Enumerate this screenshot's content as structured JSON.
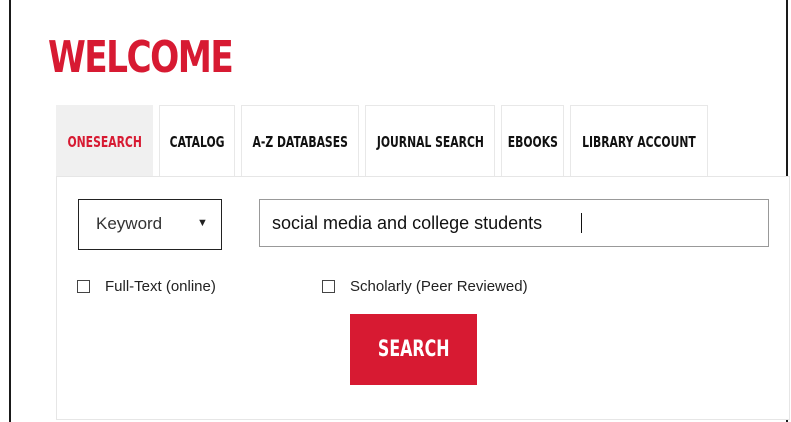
{
  "header": {
    "title": "WELCOME"
  },
  "tabs": [
    {
      "label": "ONESEARCH",
      "active": true
    },
    {
      "label": "CATALOG",
      "active": false
    },
    {
      "label": "A-Z DATABASES",
      "active": false
    },
    {
      "label": "JOURNAL SEARCH",
      "active": false
    },
    {
      "label": "EBOOKS",
      "active": false
    },
    {
      "label": "LIBRARY ACCOUNT",
      "active": false
    }
  ],
  "search": {
    "field_select": {
      "value": "Keyword",
      "icon": "caret-down-icon"
    },
    "query": "social media and college students",
    "filters": [
      {
        "label": "Full-Text (online)",
        "checked": false
      },
      {
        "label": "Scholarly (Peer Reviewed)",
        "checked": false
      }
    ],
    "button_label": "SEARCH"
  },
  "colors": {
    "accent": "#d71a32",
    "active_tab_bg": "#f0f0f0"
  }
}
